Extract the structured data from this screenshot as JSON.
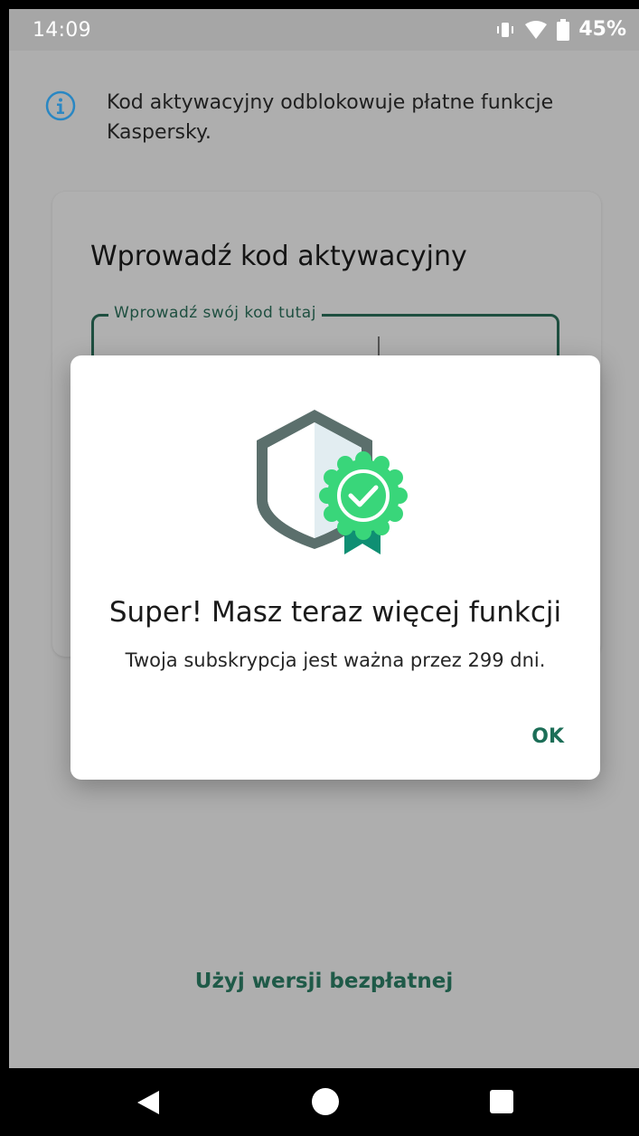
{
  "status_bar": {
    "time": "14:09",
    "battery_percent": "45%",
    "icons": [
      "vibrate-icon",
      "wifi-icon",
      "battery-icon"
    ]
  },
  "info": {
    "icon": "info-icon",
    "text": "Kod aktywacyjny odblokowuje płatne funkcje Kaspersky."
  },
  "activation_card": {
    "title": "Wprowadź kod aktywacyjny",
    "field_label": "Wprowadź swój kod tutaj",
    "field_value": ""
  },
  "free_version_link": "Użyj wersji bezpłatnej",
  "dialog": {
    "illustration": "shield-badge-check-icon",
    "title": "Super! Masz teraz więcej funkcji",
    "message": "Twoja subskrypcja jest ważna przez 299 dni.",
    "ok_label": "OK"
  },
  "nav_bar": {
    "icons": [
      "back-icon",
      "home-icon",
      "recents-icon"
    ]
  },
  "colors": {
    "accent_green": "#1c6e57",
    "badge_green": "#39d67a",
    "shield_gray": "#5b6f6c",
    "info_blue": "#2a87c3"
  }
}
